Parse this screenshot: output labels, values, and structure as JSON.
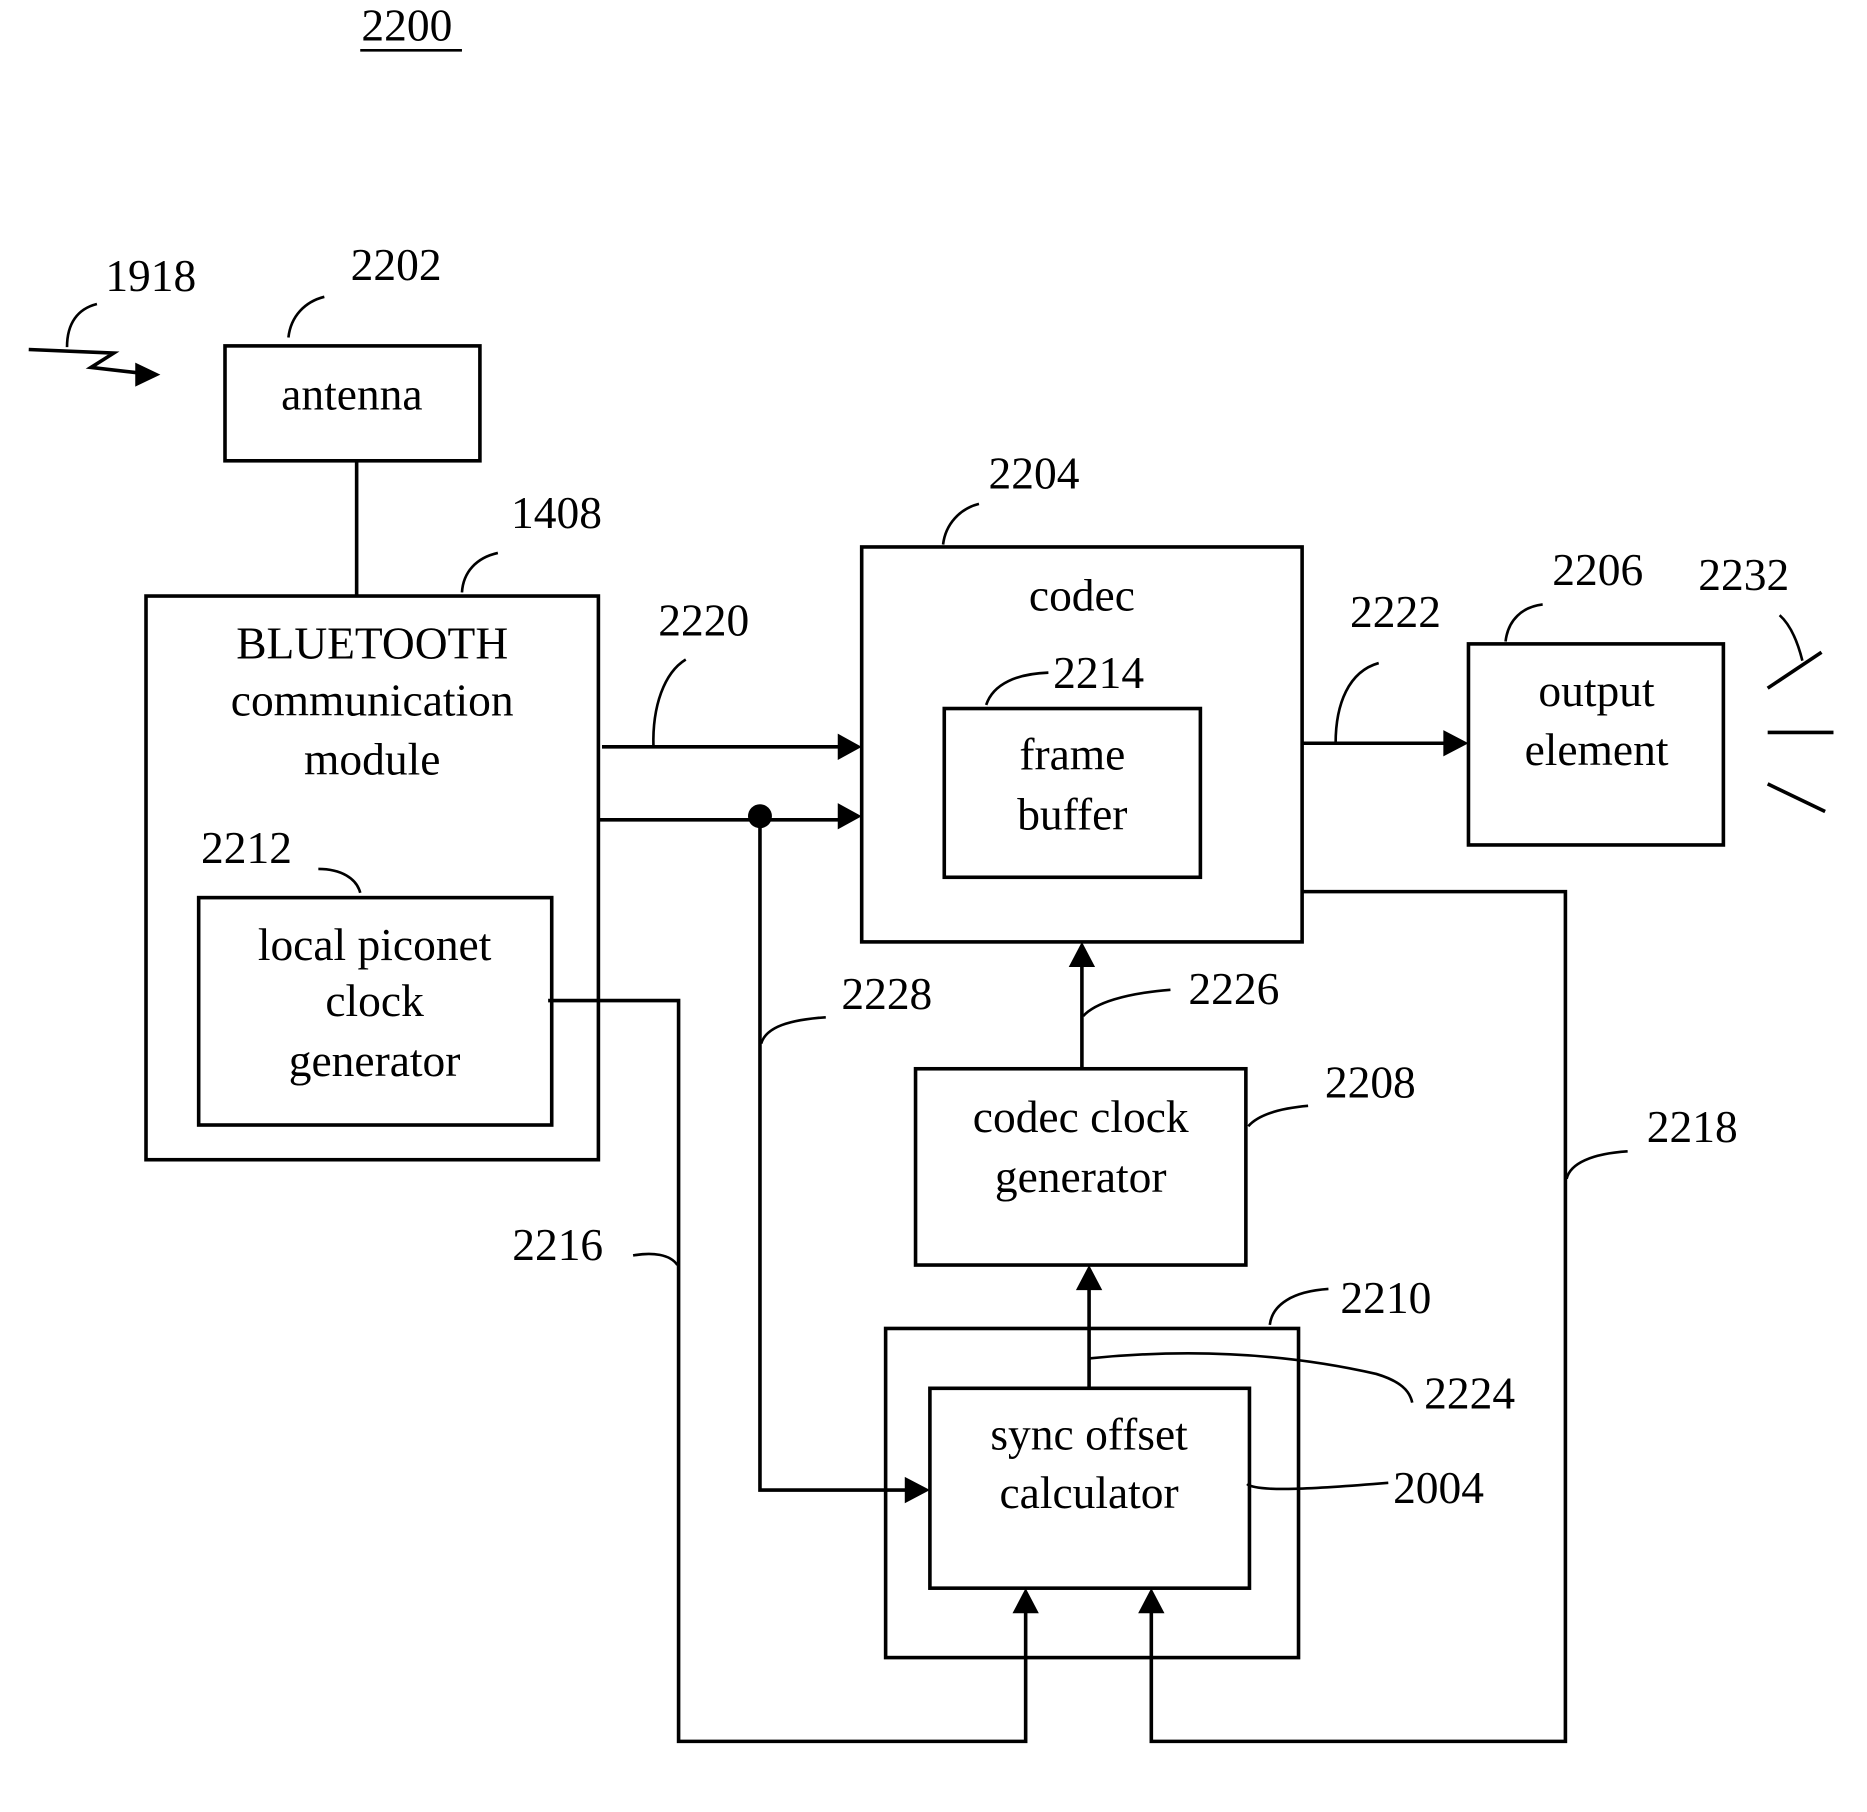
{
  "figure": {
    "number": "2200",
    "signal_ref": "1918"
  },
  "blocks": {
    "antenna": {
      "ref": "2202",
      "lines": [
        "antenna"
      ]
    },
    "bluetooth": {
      "ref": "1408",
      "lines": [
        "BLUETOOTH",
        "communication",
        "module"
      ]
    },
    "piconet_clock": {
      "ref": "2212",
      "lines": [
        "local piconet",
        "clock",
        "generator"
      ]
    },
    "codec": {
      "ref": "2204",
      "lines": [
        "codec"
      ]
    },
    "frame_buffer": {
      "ref": "2214",
      "lines": [
        "frame",
        "buffer"
      ]
    },
    "output_element": {
      "ref": "2206",
      "lines": [
        "output",
        "element"
      ]
    },
    "codec_clock": {
      "ref": "2208",
      "lines": [
        "codec clock",
        "generator"
      ]
    },
    "sync_container": {
      "ref": "2210"
    },
    "sync_offset": {
      "ref": "2004",
      "lines": [
        "sync offset",
        "calculator"
      ]
    }
  },
  "connections": {
    "bt_to_codec_data": "2220",
    "codec_to_output": "2222",
    "output_emission": "2232",
    "codec_clock_to_codec": "2226",
    "bt_clock_tap": "2228",
    "sync_to_codec_clock": "2224",
    "piconet_to_sync": "2216",
    "codec_to_sync": "2218"
  }
}
